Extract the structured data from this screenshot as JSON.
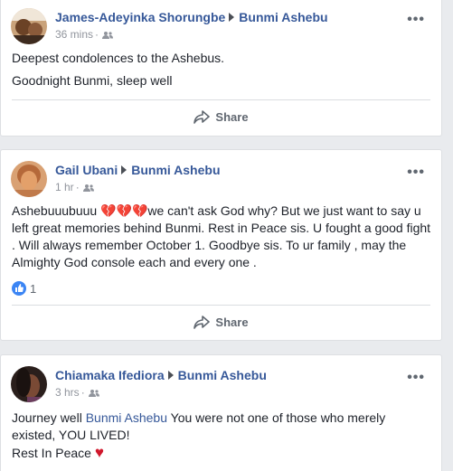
{
  "posts": [
    {
      "author": "James-Adeyinka Shorungbe",
      "target": "Bunmi Ashebu",
      "time": "36 mins",
      "lines": [
        "Deepest condolences to the Ashebus.",
        "Goodnight Bunmi, sleep well"
      ],
      "share_label": "Share",
      "more_label": "•••"
    },
    {
      "author": "Gail Ubani",
      "target": "Bunmi Ashebu",
      "time": "1 hr",
      "text_pre": "Ashebuuubuuu ",
      "hearts": "💔💔💔",
      "text_rest_line1": "we can't ask God why? But we just want to say u",
      "text_line2": "left great memories behind Bunmi. Rest in Peace sis. U fought a good fight",
      "text_line3": ". Will always remember October 1. Goodbye sis. To ur family , may the",
      "text_line4": "Almighty God console each and every one .",
      "like_count": "1",
      "share_label": "Share",
      "more_label": "•••"
    },
    {
      "author": "Chiamaka Ifediora",
      "target": "Bunmi Ashebu",
      "time": "3 hrs",
      "line1_pre": "Journey well ",
      "line1_link": "Bunmi Ashebu",
      "line1_post": " You were not one of those who merely",
      "line2": "existed, YOU LIVED!",
      "line3_text": "Rest In Peace ",
      "line3_heart": "♥",
      "more_label": "•••"
    }
  ],
  "colors": {
    "link": "#365899",
    "like": "#3b85f4",
    "heart": "#d0182c"
  },
  "icons": {
    "audience": "friends-icon",
    "share": "share-arrow-icon",
    "like": "thumbs-up-icon"
  }
}
